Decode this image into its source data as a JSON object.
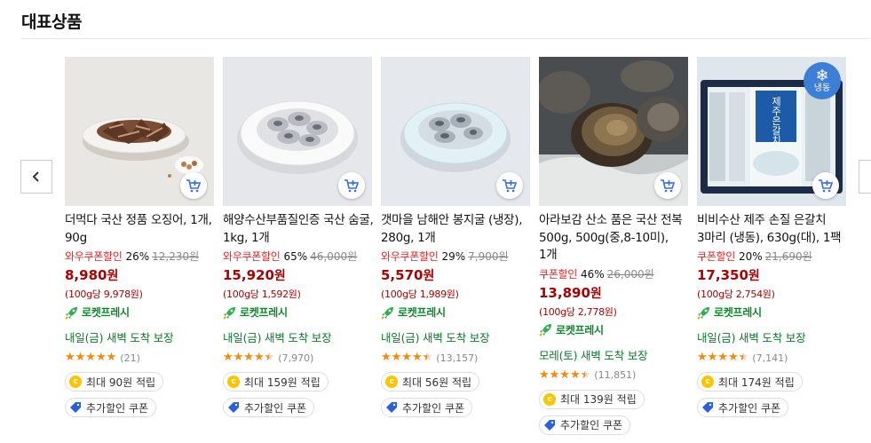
{
  "section": {
    "title": "대표상품"
  },
  "products": [
    {
      "name": "더먹다 국산 정품 오징어, 1개, 90g",
      "coupon_label": "와우쿠폰할인",
      "discount_rate": "26%",
      "original_price": "12,230원",
      "sale_price": "8,980",
      "won": "원",
      "unit_price": "(100g당 9,978원)",
      "rocket_label": "로켓프레시",
      "arrival": "내일(금) 새벽 도착 보장",
      "rating": 5.0,
      "review_count": "(21)",
      "points": "최대 90원 적립",
      "extra_coupon": "추가할인 쿠폰",
      "frozen": false
    },
    {
      "name": "해양수산부품질인증 국산 숨굴, 1kg, 1개",
      "coupon_label": "와우쿠폰할인",
      "discount_rate": "65%",
      "original_price": "46,000원",
      "sale_price": "15,920",
      "won": "원",
      "unit_price": "(100g당 1,592원)",
      "rocket_label": "로켓프레시",
      "arrival": "내일(금) 새벽 도착 보장",
      "rating": 4.5,
      "review_count": "(7,970)",
      "points": "최대 159원 적립",
      "extra_coupon": "추가할인 쿠폰",
      "frozen": false
    },
    {
      "name": "갯마을 남해안 봉지굴 (냉장), 280g, 1개",
      "coupon_label": "와우쿠폰할인",
      "discount_rate": "29%",
      "original_price": "7,900원",
      "sale_price": "5,570",
      "won": "원",
      "unit_price": "(100g당 1,989원)",
      "rocket_label": "로켓프레시",
      "arrival": "내일(금) 새벽 도착 보장",
      "rating": 4.5,
      "review_count": "(13,157)",
      "points": "최대 56원 적립",
      "extra_coupon": "추가할인 쿠폰",
      "frozen": false
    },
    {
      "name": "아라보감 산소 품은 국산 전복 500g, 500g(중,8-10미), 1개",
      "coupon_label": "쿠폰할인",
      "discount_rate": "46%",
      "original_price": "26,000원",
      "sale_price": "13,890",
      "won": "원",
      "unit_price": "(100g당 2,778원)",
      "rocket_label": "로켓프레시",
      "arrival": "모레(토) 새벽 도착 보장",
      "rating": 4.5,
      "review_count": "(11,851)",
      "points": "최대 139원 적립",
      "extra_coupon": "추가할인 쿠폰",
      "frozen": false
    },
    {
      "name": "비비수산 제주 손질 은갈치 3마리 (냉동), 630g(대), 1팩",
      "coupon_label": "쿠폰할인",
      "discount_rate": "20%",
      "original_price": "21,690원",
      "sale_price": "17,350",
      "won": "원",
      "unit_price": "(100g당 2,754원)",
      "rocket_label": "로켓프레시",
      "arrival": "내일(금) 새벽 도착 보장",
      "rating": 4.5,
      "review_count": "(7,141)",
      "points": "최대 174원 적립",
      "extra_coupon": "추가할인 쿠폰",
      "frozen": true,
      "frozen_label": "냉동",
      "package_text": "제주은갈치"
    }
  ],
  "icons": {
    "prev": "chevron-left-icon",
    "next": "chevron-right-icon",
    "cart": "cart-plus-icon",
    "rocket": "rocket-icon",
    "coin": "coin-icon",
    "coupon": "coupon-tag-icon",
    "frozen": "snowflake-icon"
  },
  "colors": {
    "sale_price": "#ae0000",
    "coupon_label": "#e52528",
    "arrival": "#0e7a2a",
    "star": "#f48b0a",
    "cart": "#346aff",
    "frozen_badge": "#3d7fd6"
  },
  "coin_glyph": "c"
}
